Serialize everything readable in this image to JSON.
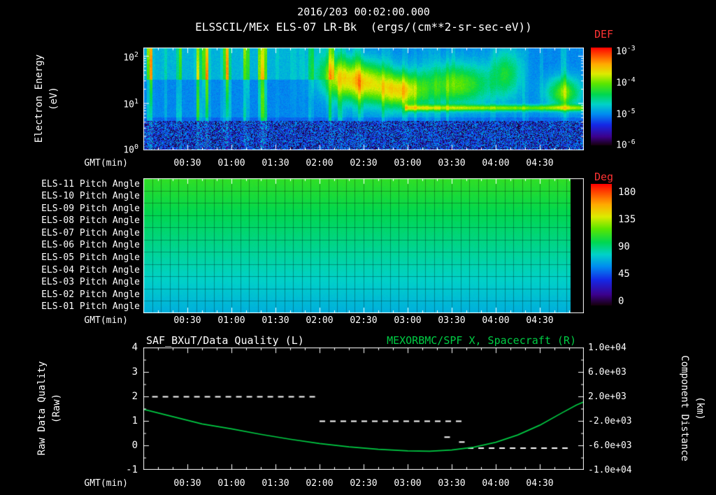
{
  "header": {
    "datetime": "2016/203 00:02:00.000",
    "spectro_title": "ELSSCIL/MEx ELS-07 LR-Bk  (ergs/(cm**2-sr-sec-eV))"
  },
  "axis_labels": {
    "gmt": "GMT(min)",
    "electron_energy_1": "Electron Energy",
    "electron_energy_2": "(eV)",
    "raw_quality_1": "Raw Data Quality",
    "raw_quality_2": "(Raw)",
    "component_distance_1": "Component Distance",
    "component_distance_2": "(km)"
  },
  "xticks": [
    "00:30",
    "01:00",
    "01:30",
    "02:00",
    "02:30",
    "03:00",
    "03:30",
    "04:00",
    "04:30"
  ],
  "spectro_yticks": [
    {
      "base": "10",
      "exp": "2"
    },
    {
      "base": "10",
      "exp": "1"
    },
    {
      "base": "10",
      "exp": "0"
    }
  ],
  "colorbars": {
    "def": {
      "label": "DEF",
      "ticks": [
        {
          "base": "10",
          "exp": "-3"
        },
        {
          "base": "10",
          "exp": "-4"
        },
        {
          "base": "10",
          "exp": "-5"
        },
        {
          "base": "10",
          "exp": "-6"
        }
      ]
    },
    "deg": {
      "label": "Deg",
      "ticks": [
        "180",
        "135",
        "90",
        "45",
        "0"
      ]
    }
  },
  "pitch_rows": [
    "ELS-11 Pitch Angle",
    "ELS-10 Pitch Angle",
    "ELS-09 Pitch Angle",
    "ELS-08 Pitch Angle",
    "ELS-07 Pitch Angle",
    "ELS-06 Pitch Angle",
    "ELS-05 Pitch Angle",
    "ELS-04 Pitch Angle",
    "ELS-03 Pitch Angle",
    "ELS-02 Pitch Angle",
    "ELS-01 Pitch Angle"
  ],
  "bottom": {
    "left_title": "SAF_BXuT/Data Quality (L)",
    "right_title": "MEXORBMC/SPF X, Spacecraft (R)",
    "left_ticks": [
      "4",
      "3",
      "2",
      "1",
      "0",
      "-1"
    ],
    "right_ticks": [
      "1.0e+04",
      "6.0e+03",
      "2.0e+03",
      "-2.0e+03",
      "-6.0e+03",
      "-1.0e+04"
    ]
  },
  "colors": {
    "bg": "#000000",
    "text": "#ffffff",
    "red": "#ff3333",
    "green": "#00cc44"
  },
  "chart_data": [
    {
      "type": "heatmap",
      "name": "electron-energy-spectrogram",
      "title": "ELSSCIL/MEx ELS-07 LR-Bk",
      "units": "ergs/(cm**2-sr-sec-eV)",
      "xlabel": "GMT(min)",
      "ylabel": "Electron Energy (eV)",
      "x_minutes_range": [
        0,
        300
      ],
      "xticks": [
        "00:30",
        "01:00",
        "01:30",
        "02:00",
        "02:30",
        "03:00",
        "03:30",
        "04:00",
        "04:30"
      ],
      "y_scale": "log",
      "y_range_ev": [
        1,
        150
      ],
      "yticks": [
        "10^2",
        "10^1",
        "10^0"
      ],
      "colorbar": {
        "label": "DEF",
        "scale": "log",
        "ticks": [
          "10^-3",
          "10^-4",
          "10^-5",
          "10^-6"
        ]
      },
      "description": "Blue background with vertical cyan-green flux streaks from 00:00-02:10; bright yellow-green enhancements 02:20-03:10 and 03:20-03:55 between ~10-60 eV; thin cyan ionospheric line near 8 eV after ~03:00; dark speckled noise below ~4 eV",
      "streaky_region_end_min": 135,
      "low_energy_noise_below_ev": 4.2,
      "enhancements": [
        {
          "t_min": 132,
          "t_sigma": 9,
          "energy_ev": 40,
          "e_sigma_dec": 0.3,
          "amp": 0.22
        },
        {
          "t_min": 150,
          "t_sigma": 13,
          "energy_ev": 28,
          "e_sigma_dec": 0.3,
          "amp": 0.4
        },
        {
          "t_min": 176,
          "t_sigma": 11,
          "energy_ev": 18,
          "e_sigma_dec": 0.26,
          "amp": 0.38
        },
        {
          "t_min": 214,
          "t_sigma": 16,
          "energy_ev": 25,
          "e_sigma_dec": 0.3,
          "amp": 0.3
        },
        {
          "t_min": 247,
          "t_sigma": 7,
          "energy_ev": 45,
          "e_sigma_dec": 0.35,
          "amp": 0.2
        },
        {
          "t_min": 286,
          "t_sigma": 8,
          "energy_ev": 17,
          "e_sigma_dec": 0.22,
          "amp": 0.3
        }
      ]
    },
    {
      "type": "heatmap",
      "name": "pitch-angle-panel",
      "rows": [
        "ELS-11 Pitch Angle",
        "ELS-10 Pitch Angle",
        "ELS-09 Pitch Angle",
        "ELS-08 Pitch Angle",
        "ELS-07 Pitch Angle",
        "ELS-06 Pitch Angle",
        "ELS-05 Pitch Angle",
        "ELS-04 Pitch Angle",
        "ELS-03 Pitch Angle",
        "ELS-02 Pitch Angle",
        "ELS-01 Pitch Angle"
      ],
      "row_mean_deg": [
        102,
        99,
        96,
        93,
        90,
        87,
        84,
        81,
        77,
        73,
        70
      ],
      "x_minutes_range": [
        0,
        300
      ],
      "xticks": [
        "00:30",
        "01:00",
        "01:30",
        "02:00",
        "02:30",
        "03:00",
        "03:30",
        "04:00",
        "04:30"
      ],
      "colorbar": {
        "label": "Deg",
        "range": [
          0,
          180
        ],
        "ticks": [
          180,
          135,
          90,
          45,
          0
        ]
      },
      "data_gap_after_min": 291
    },
    {
      "type": "line",
      "name": "quality-and-distance",
      "left_title": "SAF_BXuT/Data Quality (L)",
      "right_title": "MEXORBMC/SPF X, Spacecraft (R)",
      "xlabel": "GMT(min)",
      "x_minutes_range": [
        0,
        300
      ],
      "xticks": [
        "00:30",
        "01:00",
        "01:30",
        "02:00",
        "02:30",
        "03:00",
        "03:30",
        "04:00",
        "04:30"
      ],
      "left_axis": {
        "label": "Raw Data Quality (Raw)",
        "range": [
          -1,
          4
        ],
        "ticks": [
          4,
          3,
          2,
          1,
          0,
          -1
        ]
      },
      "right_axis": {
        "label": "Component Distance (km)",
        "range": [
          -10000,
          10000
        ],
        "ticks": [
          "1.0e+04",
          "6.0e+03",
          "2.0e+03",
          "-2.0e+03",
          "-6.0e+03",
          "-1.0e+04"
        ]
      },
      "series": [
        {
          "name": "SAF_BXuT/Data Quality",
          "axis": "left",
          "style": "dashed",
          "color": "#ffffff",
          "segments": [
            {
              "t_start": 6,
              "t_end": 120,
              "value": 2
            },
            {
              "t_start": 120,
              "t_end": 219,
              "value": 1
            },
            {
              "t_start": 205,
              "t_end": 210,
              "value": 0.35
            },
            {
              "t_start": 215,
              "t_end": 220,
              "value": 0.15
            },
            {
              "t_start": 221,
              "t_end": 289,
              "value": -0.1
            }
          ]
        },
        {
          "name": "MEXORBMC/SPF X Spacecraft",
          "axis": "right",
          "style": "solid",
          "color": "#00cc44",
          "points_t_km": [
            [
              0,
              -100
            ],
            [
              20,
              -1300
            ],
            [
              40,
              -2500
            ],
            [
              60,
              -3300
            ],
            [
              80,
              -4200
            ],
            [
              100,
              -5000
            ],
            [
              120,
              -5700
            ],
            [
              140,
              -6250
            ],
            [
              160,
              -6650
            ],
            [
              180,
              -6900
            ],
            [
              195,
              -6950
            ],
            [
              210,
              -6750
            ],
            [
              225,
              -6300
            ],
            [
              240,
              -5500
            ],
            [
              255,
              -4300
            ],
            [
              270,
              -2700
            ],
            [
              285,
              -700
            ],
            [
              295,
              600
            ],
            [
              300,
              1100
            ]
          ]
        }
      ]
    }
  ]
}
